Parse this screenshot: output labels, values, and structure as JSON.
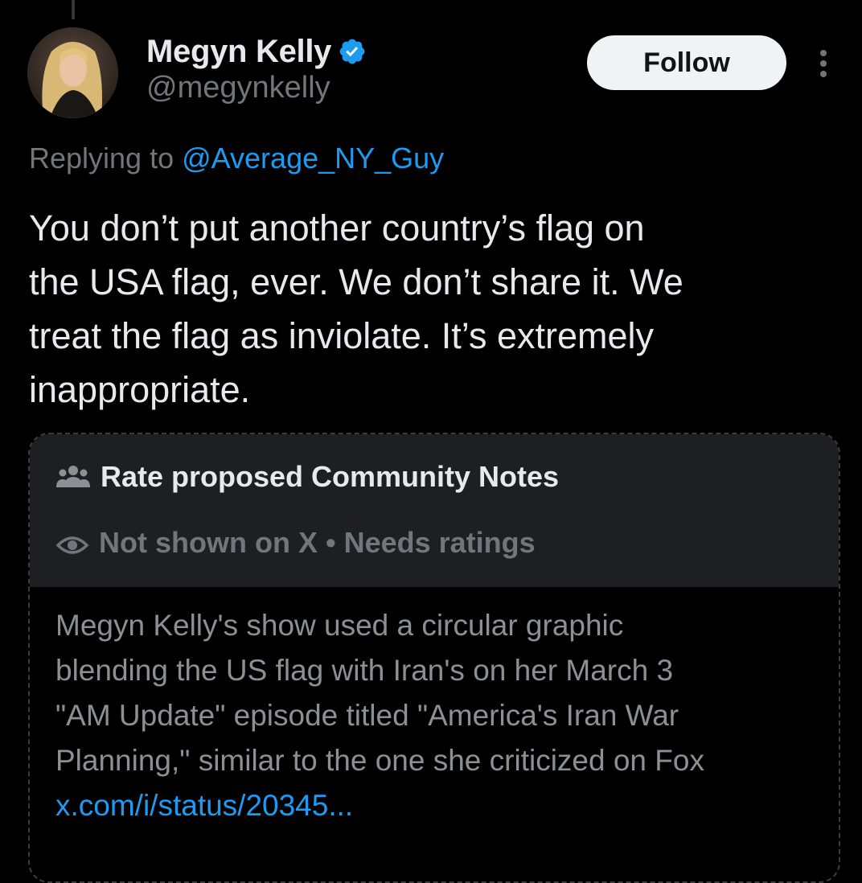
{
  "tweet": {
    "author": {
      "display_name": "Megyn Kelly",
      "handle": "@megynkelly",
      "verified": true
    },
    "follow_label": "Follow",
    "replying_prefix": "Replying to",
    "replying_to": "@Average_NY_Guy",
    "text_lines": [
      "You don’t put another country’s flag on",
      "the USA flag, ever. We don’t share it. We",
      "treat the flag as inviolate. It’s extremely",
      "inappropriate."
    ]
  },
  "community_note": {
    "title": "Rate proposed Community Notes",
    "status": "Not shown on X",
    "separator": "•",
    "status_detail": "Needs ratings",
    "body_lines": [
      "Megyn Kelly's show used a circular graphic",
      "blending the US flag with Iran's on her March 3",
      "\"AM Update\" episode titled \"America's Iran War",
      "Planning,\"  similar to the one she criticized on Fox"
    ],
    "link": "x.com/i/status/20345..."
  },
  "colors": {
    "background": "#000000",
    "accent": "#1d9bf0",
    "muted": "#71767b",
    "note_header_bg": "#1d1f23"
  },
  "icons": {
    "verified": "verified-badge-icon",
    "more": "more-vertical-icon",
    "people": "people-icon",
    "eye": "eye-icon"
  }
}
